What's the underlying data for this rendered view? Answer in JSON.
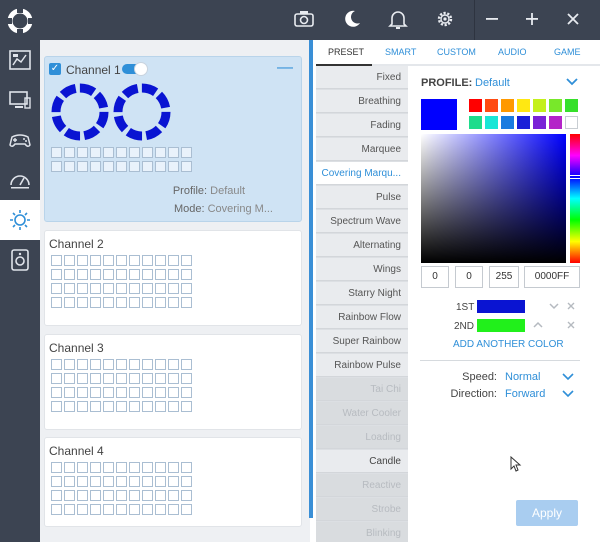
{
  "topbar": {
    "icons": [
      "camera-icon",
      "moon-icon",
      "bell-icon",
      "gear-icon"
    ],
    "window": [
      "minimize-icon",
      "maximize-icon",
      "close-icon"
    ]
  },
  "rail": {
    "items": [
      "dashboard-icon",
      "monitor-icon",
      "gamepad-icon",
      "gauge-icon",
      "lighting-icon",
      "speaker-icon"
    ]
  },
  "channels": [
    {
      "title": "Channel 1",
      "profile_key": "Profile:",
      "profile_val": "Default",
      "mode_key": "Mode:",
      "mode_val": "Covering M..."
    },
    {
      "title": "Channel 2"
    },
    {
      "title": "Channel 3"
    },
    {
      "title": "Channel 4"
    }
  ],
  "tabs": [
    "PRESET",
    "SMART",
    "CUSTOM",
    "AUDIO",
    "GAME"
  ],
  "effects": [
    "Fixed",
    "Breathing",
    "Fading",
    "Marquee",
    "Covering Marqu...",
    "Pulse",
    "Spectrum Wave",
    "Alternating",
    "Wings",
    "Starry Night",
    "Rainbow Flow",
    "Super Rainbow",
    "Rainbow Pulse",
    "Tai Chi",
    "Water Cooler",
    "Loading",
    "Candle",
    "Reactive",
    "Strobe",
    "Blinking"
  ],
  "panel": {
    "profile_label": "PROFILE:",
    "profile_value": "Default",
    "rgb": {
      "r": "0",
      "g": "0",
      "b": "255",
      "hex": "0000FF"
    },
    "first_label": "1ST",
    "second_label": "2ND",
    "add_color": "ADD ANOTHER COLOR",
    "speed_label": "Speed:",
    "speed_value": "Normal",
    "direction_label": "Direction:",
    "direction_value": "Forward",
    "apply": "Apply"
  },
  "colors": {
    "accent": "#2f8fd8",
    "current": "#0000ff",
    "first": "#0a14d2",
    "second": "#21f01b",
    "swatches": [
      "#ff0000",
      "#ff4a12",
      "#ff9900",
      "#ffe812",
      "#c4f01c",
      "#78e82a",
      "#36e02a",
      "#1edc8c",
      "#19e6d6",
      "#1a7ce0",
      "#1a20d8",
      "#7a22d6",
      "#b424c8",
      "#ffffff"
    ]
  }
}
